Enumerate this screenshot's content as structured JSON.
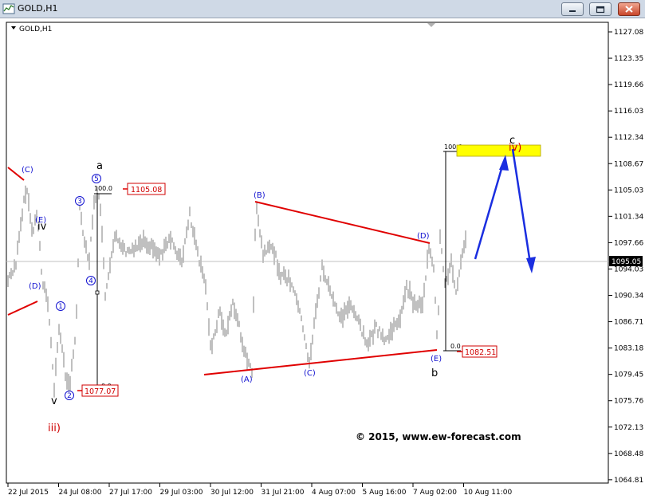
{
  "window": {
    "title": "GOLD,H1",
    "buttons": [
      "minimize-button",
      "restore-button",
      "close-button"
    ]
  },
  "chart": {
    "label": "GOLD,H1",
    "current_price": "1095.05",
    "copyright": "© 2015, www.ew-forecast.com"
  },
  "y_axis": {
    "ticks": [
      "1127.08",
      "1123.35",
      "1119.66",
      "1116.03",
      "1112.34",
      "1108.67",
      "1105.03",
      "1101.34",
      "1097.66",
      "1094.03",
      "1090.34",
      "1086.71",
      "1083.18",
      "1079.45",
      "1075.76",
      "1072.13",
      "1068.48",
      "1064.81"
    ]
  },
  "x_axis": {
    "ticks": [
      "22 Jul 2015",
      "24 Jul 08:00",
      "27 Jul 17:00",
      "29 Jul 03:00",
      "30 Jul 12:00",
      "31 Jul 21:00",
      "4 Aug 07:00",
      "5 Aug 16:00",
      "7 Aug 02:00",
      "10 Aug 11:00"
    ]
  },
  "price_boxes": {
    "high_a": "1105.08",
    "low_v": "1077.07",
    "low_b": "1082.51"
  },
  "fib_labels": {
    "a_100": "100.0",
    "a_0": "0.0",
    "b_100": "100.0",
    "b_0": "0.0"
  },
  "wave_labels": {
    "C": "(C)",
    "E_top": "(E)",
    "D_left": "(D)",
    "iv": "iv",
    "v": "v",
    "iii": "iii)",
    "a": "a",
    "w5": "5",
    "w3": "3",
    "w4": "4",
    "w1": "1",
    "w2": "2",
    "A": "(A)",
    "B": "(B)",
    "Cb": "(C)",
    "D_right": "(D)",
    "E_bottom": "(E)",
    "b": "b",
    "c": "c",
    "iv_right": "iv)"
  },
  "colors": {
    "price": "#808080",
    "trendline": "#e00000",
    "wave_blue": "#1010d0",
    "wave_red": "#d00000",
    "target_zone": "#ffff00",
    "forecast_arrow": "#1a2ee0"
  }
}
